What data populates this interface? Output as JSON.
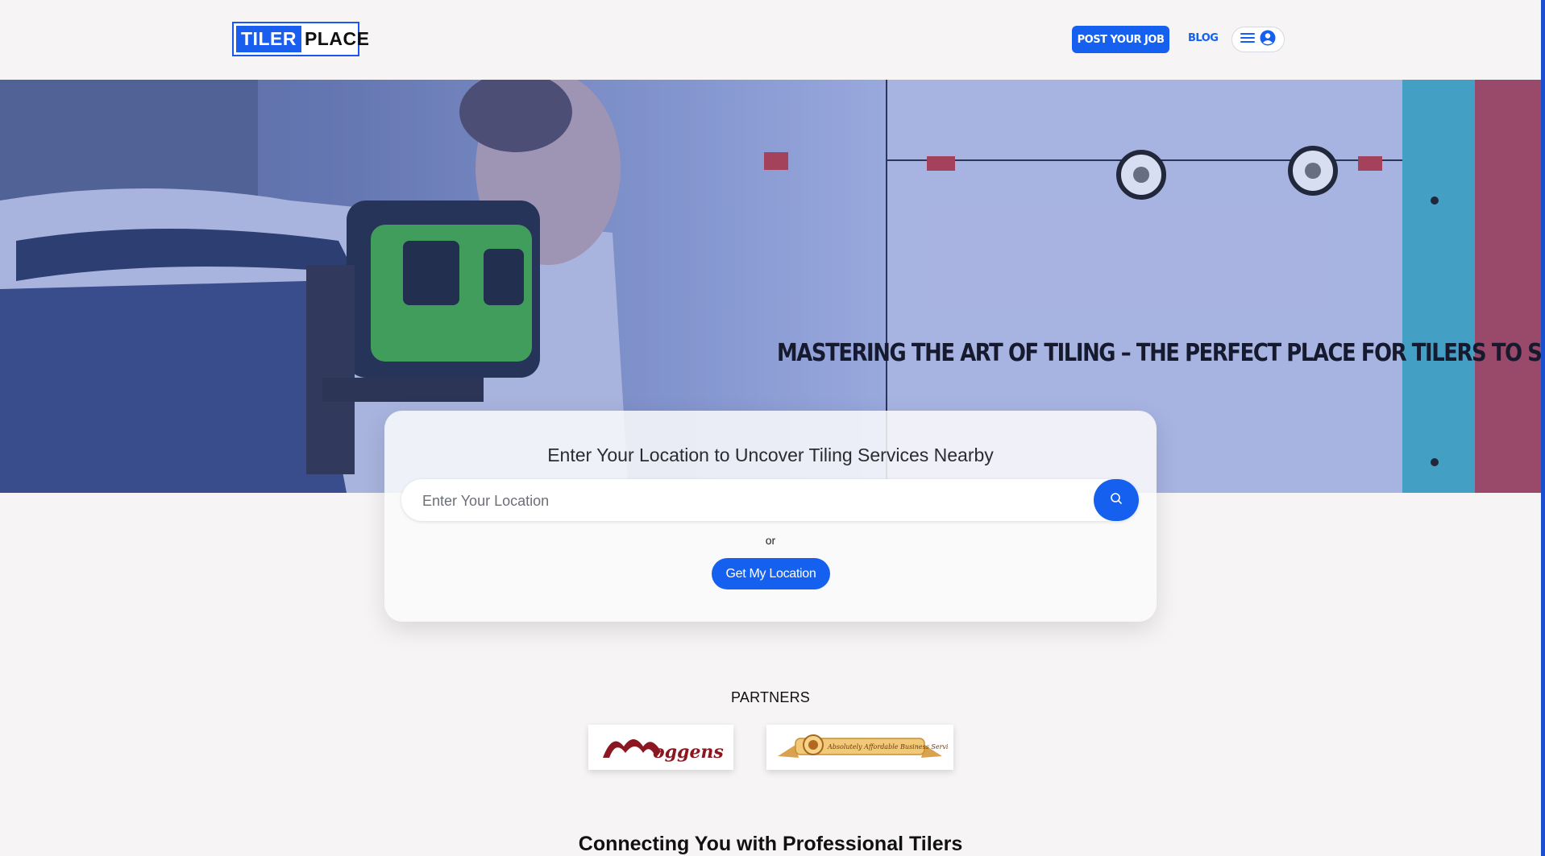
{
  "header": {
    "logo_part1": "TILER",
    "logo_part2": "PLACE",
    "post_job_label": "POST YOUR JOB",
    "blog_label": "BLOG",
    "menu_icon": "hamburger-icon",
    "user_icon": "user-circle-icon"
  },
  "hero": {
    "title": "MASTERING THE ART OF TILING – THE PERFECT PLACE FOR TILERS TO SHINE."
  },
  "search": {
    "heading": "Enter Your Location to Uncover Tiling Services Nearby",
    "placeholder": "Enter Your Location",
    "value": "",
    "or_text": "or",
    "geo_button_label": "Get My Location",
    "search_icon": "search-icon"
  },
  "partners": {
    "title": "PARTNERS",
    "items": [
      {
        "name": "oggens",
        "logo": "moggens-logo"
      },
      {
        "name": "Absolutely Affordable Business Services",
        "logo": "aabs-ribbon-logo"
      }
    ]
  },
  "section2": {
    "title": "Connecting You with Professional Tilers"
  },
  "colors": {
    "primary": "#1560ee",
    "page_bg": "#f6f4f5",
    "hero_tint": "#9aa8d6",
    "moggens_red": "#8b1820",
    "ribbon_gold": "#e6b45a"
  }
}
